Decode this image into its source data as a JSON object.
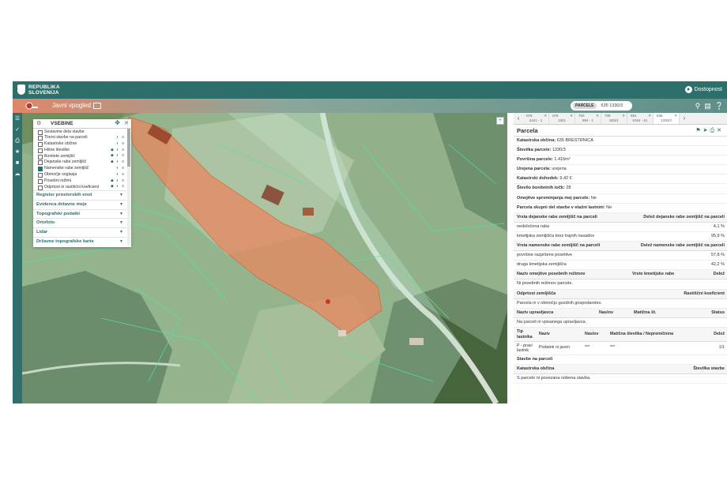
{
  "header": {
    "brand_line1": "REPUBLIKA",
    "brand_line2": "SLOVENIJA",
    "access_label": "Dostopnost",
    "access_icon": "accessibility-icon"
  },
  "subheader": {
    "title": "Javni vpogled",
    "search_chip": "PARCELE",
    "search_value": "635 1330/3"
  },
  "layers_panel": {
    "title": "VSEBINE",
    "items": [
      {
        "label": "Sestavine dela stavbe",
        "checked": false,
        "icons": ""
      },
      {
        "label": "Tlorisi stavbe na parceli",
        "checked": false,
        "icons": "◐ ≡"
      },
      {
        "label": "Katastrske občine",
        "checked": false,
        "icons": "◐ ≡"
      },
      {
        "label": "Hišne številke",
        "checked": false,
        "icons": "◆ ◐ ≡"
      },
      {
        "label": "Bonitete zemljišč",
        "checked": false,
        "icons": "◆ ◐ ≡"
      },
      {
        "label": "Dejanske rabe zemljišč",
        "checked": false,
        "icons": "◆ ◐ ≡"
      },
      {
        "label": "Namenske rabe zemljišč",
        "checked": true,
        "icons": "◐ ≡"
      },
      {
        "label": "Območje soglasja",
        "checked": false,
        "icons": "◐ ≡"
      },
      {
        "label": "Posebni režimi",
        "checked": false,
        "icons": "◆ ◐ ≡"
      },
      {
        "label": "Odprtost in rastiščni koeficient",
        "checked": false,
        "icons": "◆ ◐ ≡"
      }
    ],
    "groups": [
      "Register prostorskih enot",
      "Evidenca državne meje",
      "Topografski podatki",
      "Ortofoto",
      "Lidar",
      "Državne topografske karte"
    ]
  },
  "panel": {
    "tabs": [
      {
        "top": "078",
        "bottom": "2441 - 1"
      },
      {
        "top": "076",
        "bottom": "1921"
      },
      {
        "top": "700",
        "bottom": "894 - 1"
      },
      {
        "top": "708",
        "bottom": "825/1"
      },
      {
        "top": "691",
        "bottom": "6164 - 61"
      },
      {
        "top": "635",
        "bottom": "1330/3"
      }
    ],
    "title": "Parcela",
    "fields": [
      {
        "label": "Katastrska občina:",
        "value": "635 BRESTRNICA"
      },
      {
        "label": "Številka parcele:",
        "value": "1330/3"
      },
      {
        "label": "Površina parcele:",
        "value": "1.416m²"
      },
      {
        "label": "Urejena parcela:",
        "value": "urejena"
      },
      {
        "label": "Katastrski dohodek:",
        "value": "9,42 €"
      },
      {
        "label": "Število bonitetnih točk:",
        "value": "28"
      },
      {
        "label": "Omejitve spreminjanja mej parcele:",
        "value": "Ne"
      },
      {
        "label": "Parcela skupni del stavbe v etažni lastnini:",
        "value": "Ne"
      }
    ],
    "dejanska": {
      "h1": "Vrsta dejanske rabe zemljišč na parceli",
      "h2": "Delež dejanske rabe zemljišč na parceli",
      "rows": [
        {
          "name": "nedoločena raba",
          "pct": "4,1 %"
        },
        {
          "name": "kmetijska zemljišča brez trajnih nasadov",
          "pct": "95,9 %"
        }
      ]
    },
    "namenska": {
      "h1": "Vrsta namenske rabe zemljišč na parceli",
      "h2": "Delež namenske rabe zemljišč na parceli",
      "rows": [
        {
          "name": "površine razpršene poselitve",
          "pct": "57,8 %"
        },
        {
          "name": "druga kmetijska zemljišča",
          "pct": "42,2 %"
        }
      ]
    },
    "rezimi": {
      "h1": "Naziv omejitve posebnih režimov",
      "h2": "Vrste kmetijske rabe",
      "h3": "Delež",
      "text": "Ni posebnih režimov parcele."
    },
    "odprtost": {
      "h1": "Odprtost zemljišča",
      "h2": "Rastiščni koeficient",
      "text": "Parcela ni v območju gozdnih gospodarstev."
    },
    "upravljavec": {
      "h1": "Naziv upravljavca",
      "h2": "Naslov",
      "h3": "Matična št.",
      "h4": "Status",
      "text": "Na parceli ni vpisanega upravljavca."
    },
    "lastnik": {
      "h_tip1": "Tip",
      "h_tip2": "lastnika",
      "h_naziv": "Naziv",
      "h_naslov": "Naslov",
      "h_maticna": "Matična številka / Nepremičnina",
      "h_delez": "Delež",
      "tip1": "P - pravi",
      "tip2": "lastnik",
      "naziv": "Podatek ni javen",
      "naslov": "***",
      "maticna": "***",
      "delez": "1/1"
    },
    "stavbe": {
      "title": "Stavbe na parceli",
      "h1": "Katastrska občina",
      "h2": "Številka stavbe",
      "text": "S parcelo ni povezana nobena stavba."
    }
  }
}
